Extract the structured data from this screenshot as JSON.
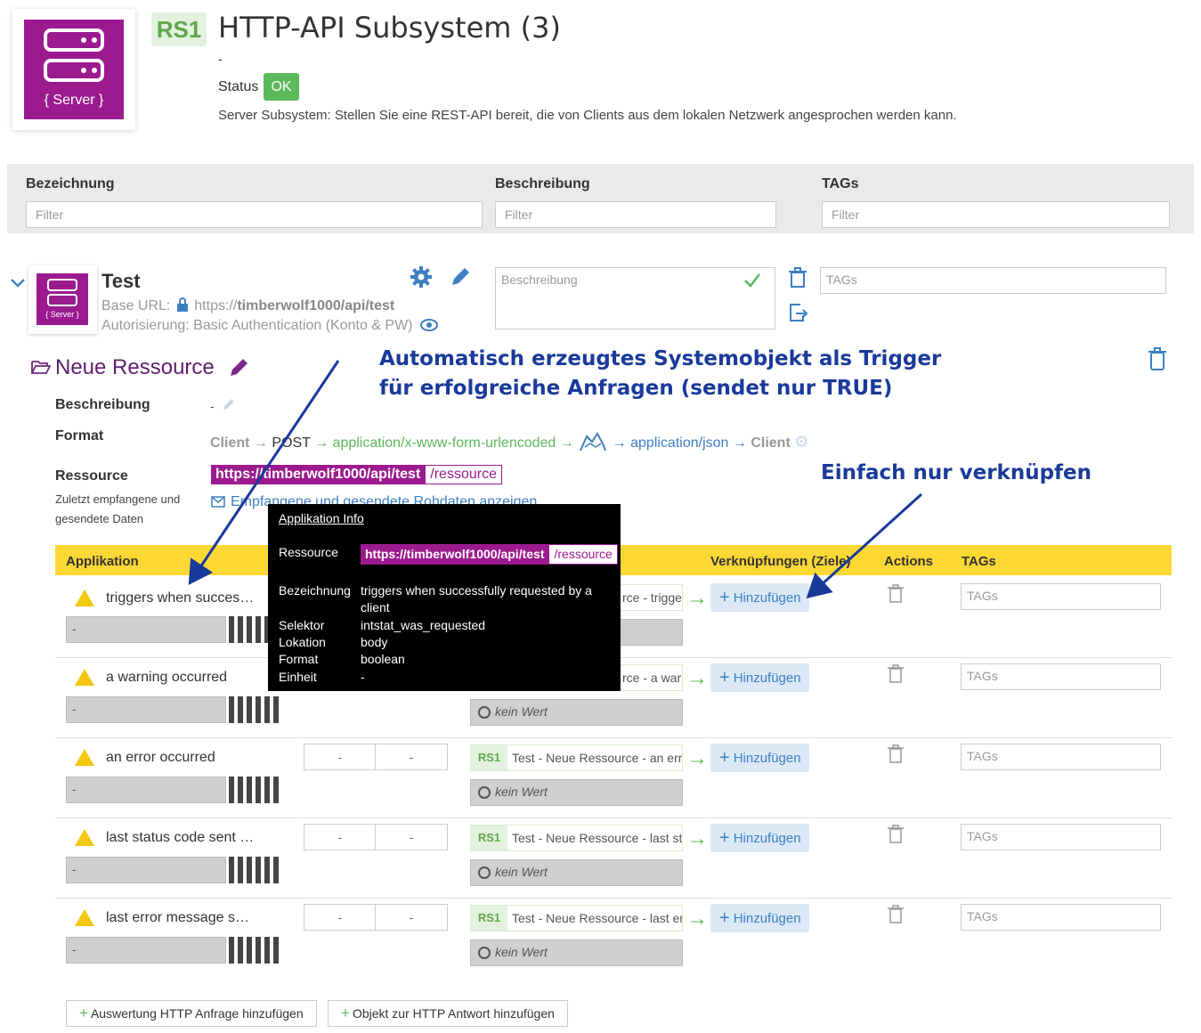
{
  "header": {
    "icon_label": "{ Server }",
    "badge": "RS1",
    "title": "HTTP-API Subsystem (3)",
    "subtitle": "-",
    "status_label": "Status",
    "status_value": "OK",
    "description": "Server Subsystem: Stellen Sie eine REST-API bereit, die von Clients aus dem lokalen Netzwerk angesprochen werden kann."
  },
  "filters": {
    "bezeichnung_label": "Bezeichnung",
    "beschreibung_label": "Beschreibung",
    "tags_label": "TAGs",
    "placeholder": "Filter"
  },
  "instance": {
    "name": "Test",
    "icon_label": "{ Server }",
    "base_url_label": "Base URL:",
    "base_url_prefix": "https://",
    "base_url_host": "timberwolf1000/api/test",
    "auth_text": "Autorisierung: Basic Authentication (Konto & PW)",
    "description_placeholder": "Beschreibung",
    "tags_placeholder": "TAGs"
  },
  "resource": {
    "title": "Neue Ressource",
    "beschreibung_label": "Beschreibung",
    "beschreibung_value": "-",
    "format_label": "Format",
    "format_client": "Client",
    "format_method": "POST",
    "format_in": "application/x-www-form-urlencoded",
    "format_out": "application/json",
    "format_client2": "Client",
    "ressource_label": "Ressource",
    "ressource_url": "https://timberwolf1000/api/test",
    "ressource_path": "/ressource",
    "last_data_label": "Zuletzt empfangene und gesendete Daten",
    "raw_link": "Empfangene und gesendete Rohdaten anzeigen"
  },
  "annotations": {
    "trigger_line1": "Automatisch erzeugtes Systemobjekt als Trigger",
    "trigger_line2": "für erfolgreiche Anfragen (sendet nur TRUE)",
    "link_note": "Einfach nur verknüpfen"
  },
  "table": {
    "headers": {
      "applikation": "Applikation",
      "links": "Verknüpfungen (Ziele)",
      "actions": "Actions",
      "tags": "TAGs"
    },
    "add_label": "Hinzufügen",
    "tags_placeholder": "TAGs",
    "no_value": "kein Wert",
    "rows": [
      {
        "name": "triggers when succes…",
        "value": "-",
        "link": "rce - trigge"
      },
      {
        "name": "a warning occurred",
        "value": "-",
        "link": "rce - a war"
      },
      {
        "name": "an error occurred",
        "value": "-",
        "min": "-",
        "max": "-",
        "link": "Test - Neue Ressource - an err"
      },
      {
        "name": "last status code sent …",
        "value": "-",
        "min": "-",
        "max": "-",
        "link": "Test - Neue Ressource - last st"
      },
      {
        "name": "last error message s…",
        "value": "-",
        "min": "-",
        "max": "-",
        "link": "Test - Neue Ressource - last er"
      }
    ]
  },
  "tooltip": {
    "title": "Applikation Info",
    "ressource_label": "Ressource",
    "ressource_url": "https://timberwolf1000/api/test",
    "ressource_path": "/ressource",
    "bezeichnung_label": "Bezeichnung",
    "bezeichnung_value": "triggers when successfully requested by a client",
    "selektor_label": "Selektor",
    "selektor_value": "intstat_was_requested",
    "lokation_label": "Lokation",
    "lokation_value": "body",
    "format_label": "Format",
    "format_value": "boolean",
    "einheit_label": "Einheit",
    "einheit_value": "-"
  },
  "footer": {
    "add_request_button": "Auswertung HTTP Anfrage hinzufügen",
    "add_response_button": "Objekt zur HTTP Antwort hinzufügen"
  },
  "colors": {
    "brand_purple": "#9b1b8f",
    "ok_green": "#5cb85c",
    "header_yellow": "#fdd835",
    "link_blue": "#3e7fc1",
    "annotation_blue": "#1a3a9a"
  }
}
